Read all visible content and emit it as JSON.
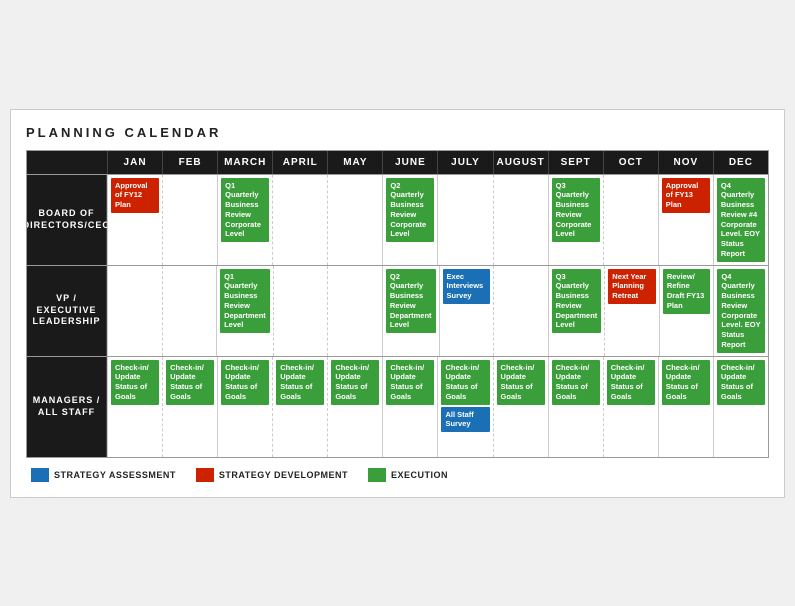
{
  "title": "PLANNING CALENDAR",
  "months": [
    "JAN",
    "FEB",
    "MARCH",
    "APRIL",
    "MAY",
    "JUNE",
    "JULY",
    "AUGUST",
    "SEPT",
    "OCT",
    "NOV",
    "DEC"
  ],
  "rows": [
    {
      "label": "BOARD OF\nDIRECTORS/CEO",
      "cells": [
        [
          {
            "text": "Approval of FY12 Plan",
            "color": "red"
          }
        ],
        [],
        [
          {
            "text": "Q1 Quarterly Business Review Corporate Level",
            "color": "green"
          }
        ],
        [],
        [],
        [
          {
            "text": "Q2 Quarterly Business Review Corporate Level",
            "color": "green"
          }
        ],
        [],
        [],
        [
          {
            "text": "Q3 Quarterly Business Review Corporate Level",
            "color": "green"
          }
        ],
        [],
        [
          {
            "text": "Approval of FY13 Plan",
            "color": "red"
          }
        ],
        [
          {
            "text": "Q4 Quarterly Business Review #4 Corporate Level. EOY Status Report",
            "color": "green"
          }
        ]
      ]
    },
    {
      "label": "VP / EXECUTIVE\nLEADERSHIP",
      "cells": [
        [],
        [],
        [
          {
            "text": "Q1 Quarterly Business Review Department Level",
            "color": "green"
          }
        ],
        [],
        [],
        [
          {
            "text": "Q2 Quarterly Business Review Department Level",
            "color": "green"
          }
        ],
        [
          {
            "text": "Exec Interviews Survey",
            "color": "blue"
          }
        ],
        [],
        [
          {
            "text": "Q3 Quarterly Business Review Department Level",
            "color": "green"
          }
        ],
        [
          {
            "text": "Next Year Planning Retreat",
            "color": "red"
          }
        ],
        [
          {
            "text": "Review/ Refine Draft FY13 Plan",
            "color": "green"
          }
        ],
        [
          {
            "text": "Q4 Quarterly Business Review Corporate Level. EOY Status Report",
            "color": "green"
          }
        ]
      ]
    },
    {
      "label": "MANAGERS /\nALL STAFF",
      "cells": [
        [
          {
            "text": "Check-in/ Update Status of Goals",
            "color": "green"
          }
        ],
        [
          {
            "text": "Check-in/ Update Status of Goals",
            "color": "green"
          }
        ],
        [
          {
            "text": "Check-in/ Update Status of Goals",
            "color": "green"
          }
        ],
        [
          {
            "text": "Check-in/ Update Status of Goals",
            "color": "green"
          }
        ],
        [
          {
            "text": "Check-in/ Update Status of Goals",
            "color": "green"
          }
        ],
        [
          {
            "text": "Check-in/ Update Status of Goals",
            "color": "green"
          }
        ],
        [
          {
            "text": "Check-in/ Update Status of Goals",
            "color": "green"
          },
          {
            "text": "All Staff Survey",
            "color": "blue"
          }
        ],
        [
          {
            "text": "Check-in/ Update Status of Goals",
            "color": "green"
          }
        ],
        [
          {
            "text": "Check-in/ Update Status of Goals",
            "color": "green"
          }
        ],
        [
          {
            "text": "Check-in/ Update Status of Goals",
            "color": "green"
          }
        ],
        [
          {
            "text": "Check-in/ Update Status of Goals",
            "color": "green"
          }
        ],
        [
          {
            "text": "Check-in/ Update Status of Goals",
            "color": "green"
          }
        ]
      ]
    }
  ],
  "legend": [
    {
      "label": "STRATEGY ASSESSMENT",
      "color": "#1a6fb5"
    },
    {
      "label": "STRATEGY DEVELOPMENT",
      "color": "#cc2200"
    },
    {
      "label": "EXECUTION",
      "color": "#3a9e3a"
    }
  ]
}
